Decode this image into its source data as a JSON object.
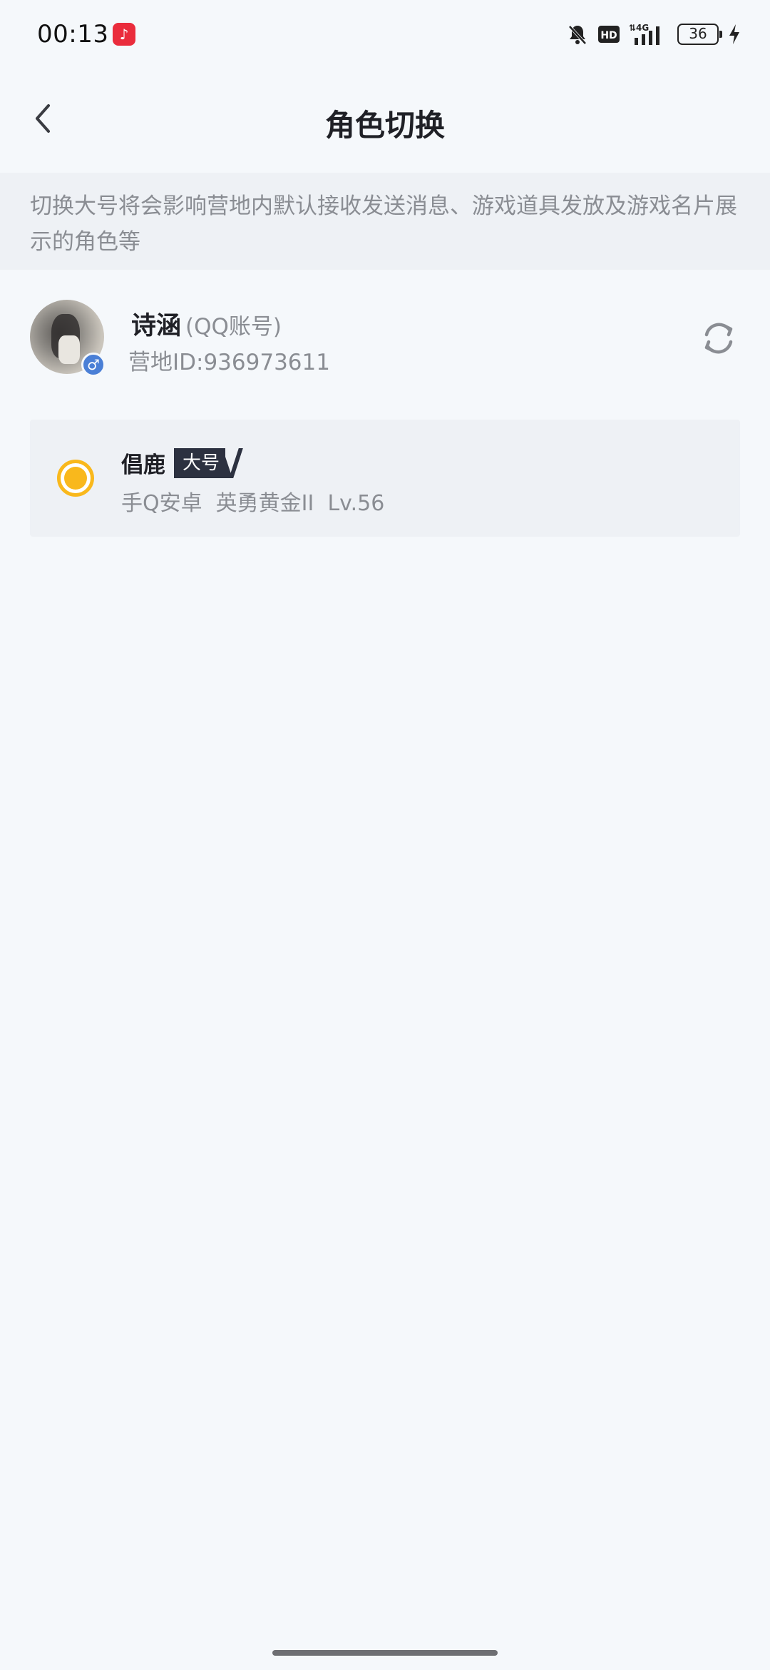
{
  "status_bar": {
    "time": "00:13",
    "app_icon": "music-app-icon",
    "icons": [
      "bell-muted-icon",
      "hd-icon",
      "signal-4g-icon"
    ],
    "battery_level": "36",
    "charging": true
  },
  "header": {
    "back_icon": "chevron-left-icon",
    "title": "角色切换"
  },
  "notice": {
    "text": "切换大号将会影响营地内默认接收发送消息、游戏道具发放及游戏名片展示的角色等"
  },
  "account": {
    "name": "诗涵",
    "type": "(QQ账号)",
    "id_text": "营地ID:936973611",
    "gender_symbol": "♂",
    "switch_icon": "refresh-icon"
  },
  "roles": [
    {
      "name": "倡鹿",
      "tag": "大号",
      "info": "手Q安卓  英勇黄金II  Lv.56",
      "selected": true
    }
  ],
  "colors": {
    "background": "#f5f8fb",
    "notice_bg": "#eef1f5",
    "accent_yellow": "#f9b81c",
    "tag_bg": "#2c3140",
    "gender_blue": "#4a7fd6"
  }
}
